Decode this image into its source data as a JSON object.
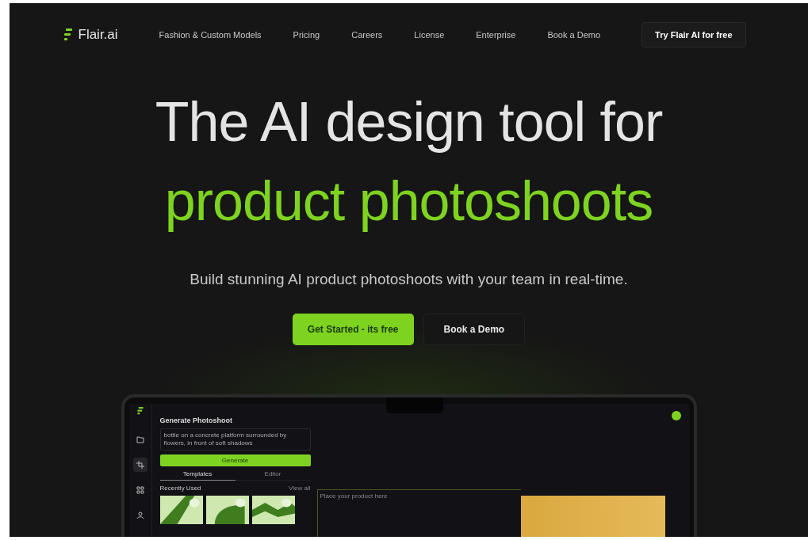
{
  "nav": {
    "logo": "Flair.ai",
    "links": [
      "Fashion & Custom Models",
      "Pricing",
      "Careers",
      "License",
      "Enterprise",
      "Book a Demo"
    ],
    "cta": "Try Flair AI  for free"
  },
  "hero": {
    "title": "The AI design tool for",
    "highlight": "product photoshoots",
    "subtitle": "Build stunning AI product photoshoots with your team in real-time.",
    "buttons": [
      {
        "label": "Get Started - its free",
        "kind": "primary"
      },
      {
        "label": "Book a Demo",
        "kind": "secondary"
      }
    ]
  },
  "app_preview": {
    "sidebar": [
      {
        "kind": "folder",
        "selected": false
      },
      {
        "kind": "crop",
        "selected": true
      },
      {
        "kind": "grid",
        "selected": false
      },
      {
        "kind": "person",
        "selected": false
      }
    ],
    "panel_title": "Generate Photoshoot",
    "prompt": "bottle on a concrete platform surrounded by flowers, in front of soft shadows",
    "generate": "Generate",
    "tabs": [
      {
        "label": "Templates",
        "selected": true
      },
      {
        "label": "Editor",
        "selected": false
      }
    ],
    "recent": "Recently Used",
    "view_all": "View all",
    "canvas_placeholder": "Place your product here"
  }
}
